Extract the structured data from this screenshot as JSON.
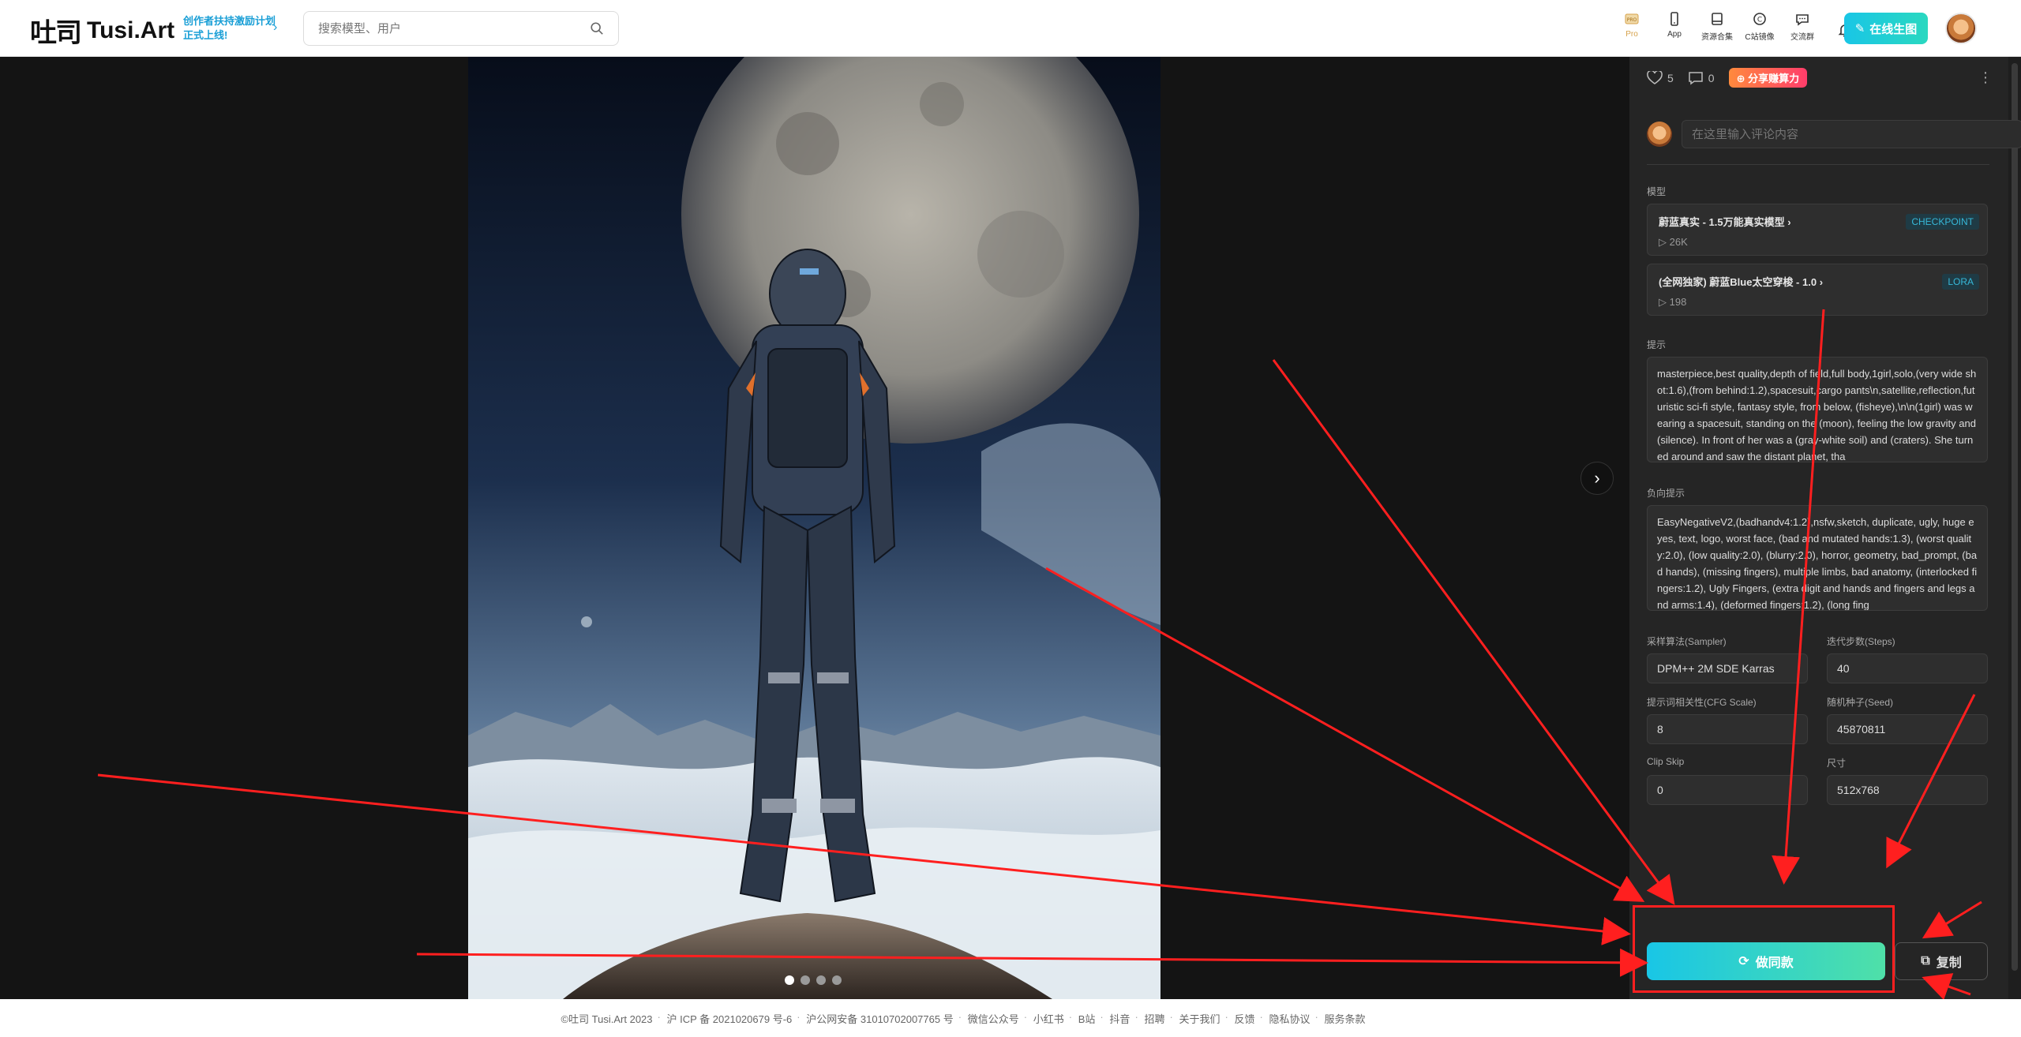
{
  "header": {
    "logo_mark": "吐司",
    "logo_text": "Tusi.Art",
    "promo_text": "创作者扶持激励计划正式上线!",
    "search_placeholder": "搜索模型、用户",
    "nav": [
      {
        "label": "Pro",
        "icon": "pro-icon"
      },
      {
        "label": "App",
        "icon": "phone-icon"
      },
      {
        "label": "资源合集",
        "icon": "book-icon"
      },
      {
        "label": "C站镜像",
        "icon": "mirror-icon"
      },
      {
        "label": "交流群",
        "icon": "chat-icon"
      },
      {
        "label": "",
        "icon": "bell-icon"
      }
    ],
    "create_label": "在线生图"
  },
  "viewer": {
    "next_icon": "chevron-right-icon",
    "dots": 4,
    "active_dot": 0
  },
  "panel": {
    "likes": "5",
    "comments": "0",
    "share_label": "分享赚算力",
    "comment_placeholder": "在这里输入评论内容",
    "model_section": "模型",
    "models": [
      {
        "name": "蔚蓝真实 - 1.5万能真实模型",
        "count": "26K",
        "tag": "CHECKPOINT"
      },
      {
        "name": "(全网独家) 蔚蓝Blue太空穿梭 - 1.0",
        "count": "198",
        "tag": "LORA"
      }
    ],
    "prompt_label": "提示",
    "prompt": "masterpiece,best quality,depth of field,full body,1girl,solo,(very wide shot:1.6),(from behind:1.2),spacesuit,cargo pants\\n,satellite,reflection,futuristic sci-fi style, fantasy style, from below, (fisheye),\\n\\n(1girl) was wearing a spacesuit, standing on the (moon), feeling the low gravity and (silence). In front of her was a (gray-white soil) and (craters). She turned around and saw the distant planet, tha",
    "negative_label": "负向提示",
    "negative": "EasyNegativeV2,(badhandv4:1.2),nsfw,sketch, duplicate, ugly, huge eyes, text, logo, worst face, (bad and mutated hands:1.3), (worst quality:2.0), (low quality:2.0), (blurry:2.0), horror, geometry, bad_prompt, (bad hands), (missing fingers), multiple limbs, bad anatomy, (interlocked fingers:1.2), Ugly Fingers, (extra digit and hands and fingers and legs and arms:1.4), (deformed fingers:1.2), (long fing",
    "params": [
      {
        "label": "采样算法(Sampler)",
        "value": "DPM++ 2M SDE Karras"
      },
      {
        "label": "迭代步数(Steps)",
        "value": "40"
      },
      {
        "label": "提示词相关性(CFG Scale)",
        "value": "8"
      },
      {
        "label": "随机种子(Seed)",
        "value": "45870811"
      },
      {
        "label": "Clip Skip",
        "value": "0"
      },
      {
        "label": "尺寸",
        "value": "512x768"
      }
    ],
    "same_label": "做同款",
    "copy_label": "复制"
  },
  "footer": {
    "items": [
      "©吐司 Tusi.Art 2023",
      "沪 ICP 备 2021020679 号-6",
      "沪公网安备 31010702007765 号",
      "微信公众号",
      "小红书",
      "B站",
      "抖音",
      "招聘",
      "关于我们",
      "反馈",
      "隐私协议",
      "服务条款"
    ]
  },
  "colors": {
    "accent": "#19c6e6",
    "annotation": "#ff1f1f",
    "panel_bg": "#252525"
  }
}
